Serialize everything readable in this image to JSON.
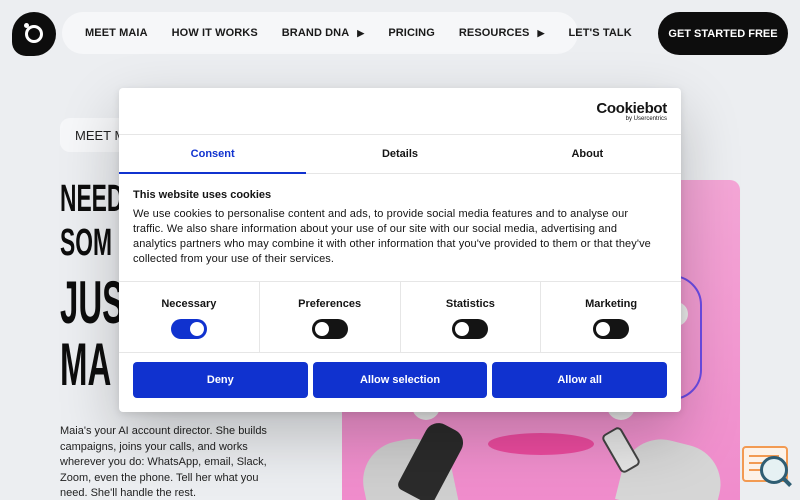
{
  "nav": {
    "items": [
      {
        "label": "MEET MAIA",
        "has_caret": false
      },
      {
        "label": "HOW IT WORKS",
        "has_caret": false
      },
      {
        "label": "BRAND DNA",
        "has_caret": true
      },
      {
        "label": "PRICING",
        "has_caret": false
      },
      {
        "label": "RESOURCES",
        "has_caret": true
      },
      {
        "label": "LET'S TALK",
        "has_caret": false
      }
    ],
    "cta_label": "GET STARTED FREE"
  },
  "hero": {
    "pill_label": "MEET M",
    "headline_lines": [
      "NEED",
      "SOM",
      "JUS",
      "MA"
    ],
    "description": "Maia's your AI account director. She builds campaigns, joins your calls, and works wherever you do: WhatsApp, email, Slack, Zoom, even the phone. Tell her what you need. She'll handle the rest."
  },
  "cookie_dialog": {
    "brand_name": "Cookiebot",
    "brand_sub": "by Usercentrics",
    "tabs": [
      {
        "label": "Consent",
        "active": true
      },
      {
        "label": "Details",
        "active": false
      },
      {
        "label": "About",
        "active": false
      }
    ],
    "title": "This website uses cookies",
    "body": "We use cookies to personalise content and ads, to provide social media features and to analyse our traffic. We also share information about your use of our site with our social media, advertising and analytics partners who may combine it with other information that you've provided to them or that they've collected from your use of their services.",
    "toggles": [
      {
        "label": "Necessary",
        "on": true
      },
      {
        "label": "Preferences",
        "on": false
      },
      {
        "label": "Statistics",
        "on": false
      },
      {
        "label": "Marketing",
        "on": false
      }
    ],
    "buttons": {
      "deny": "Deny",
      "allow_selection": "Allow selection",
      "allow_all": "Allow all"
    }
  },
  "colors": {
    "accent_blue": "#1032cf",
    "page_bg": "#eceef1",
    "hero_pink": "#f4a6d6",
    "dark": "#0d0d0d"
  }
}
